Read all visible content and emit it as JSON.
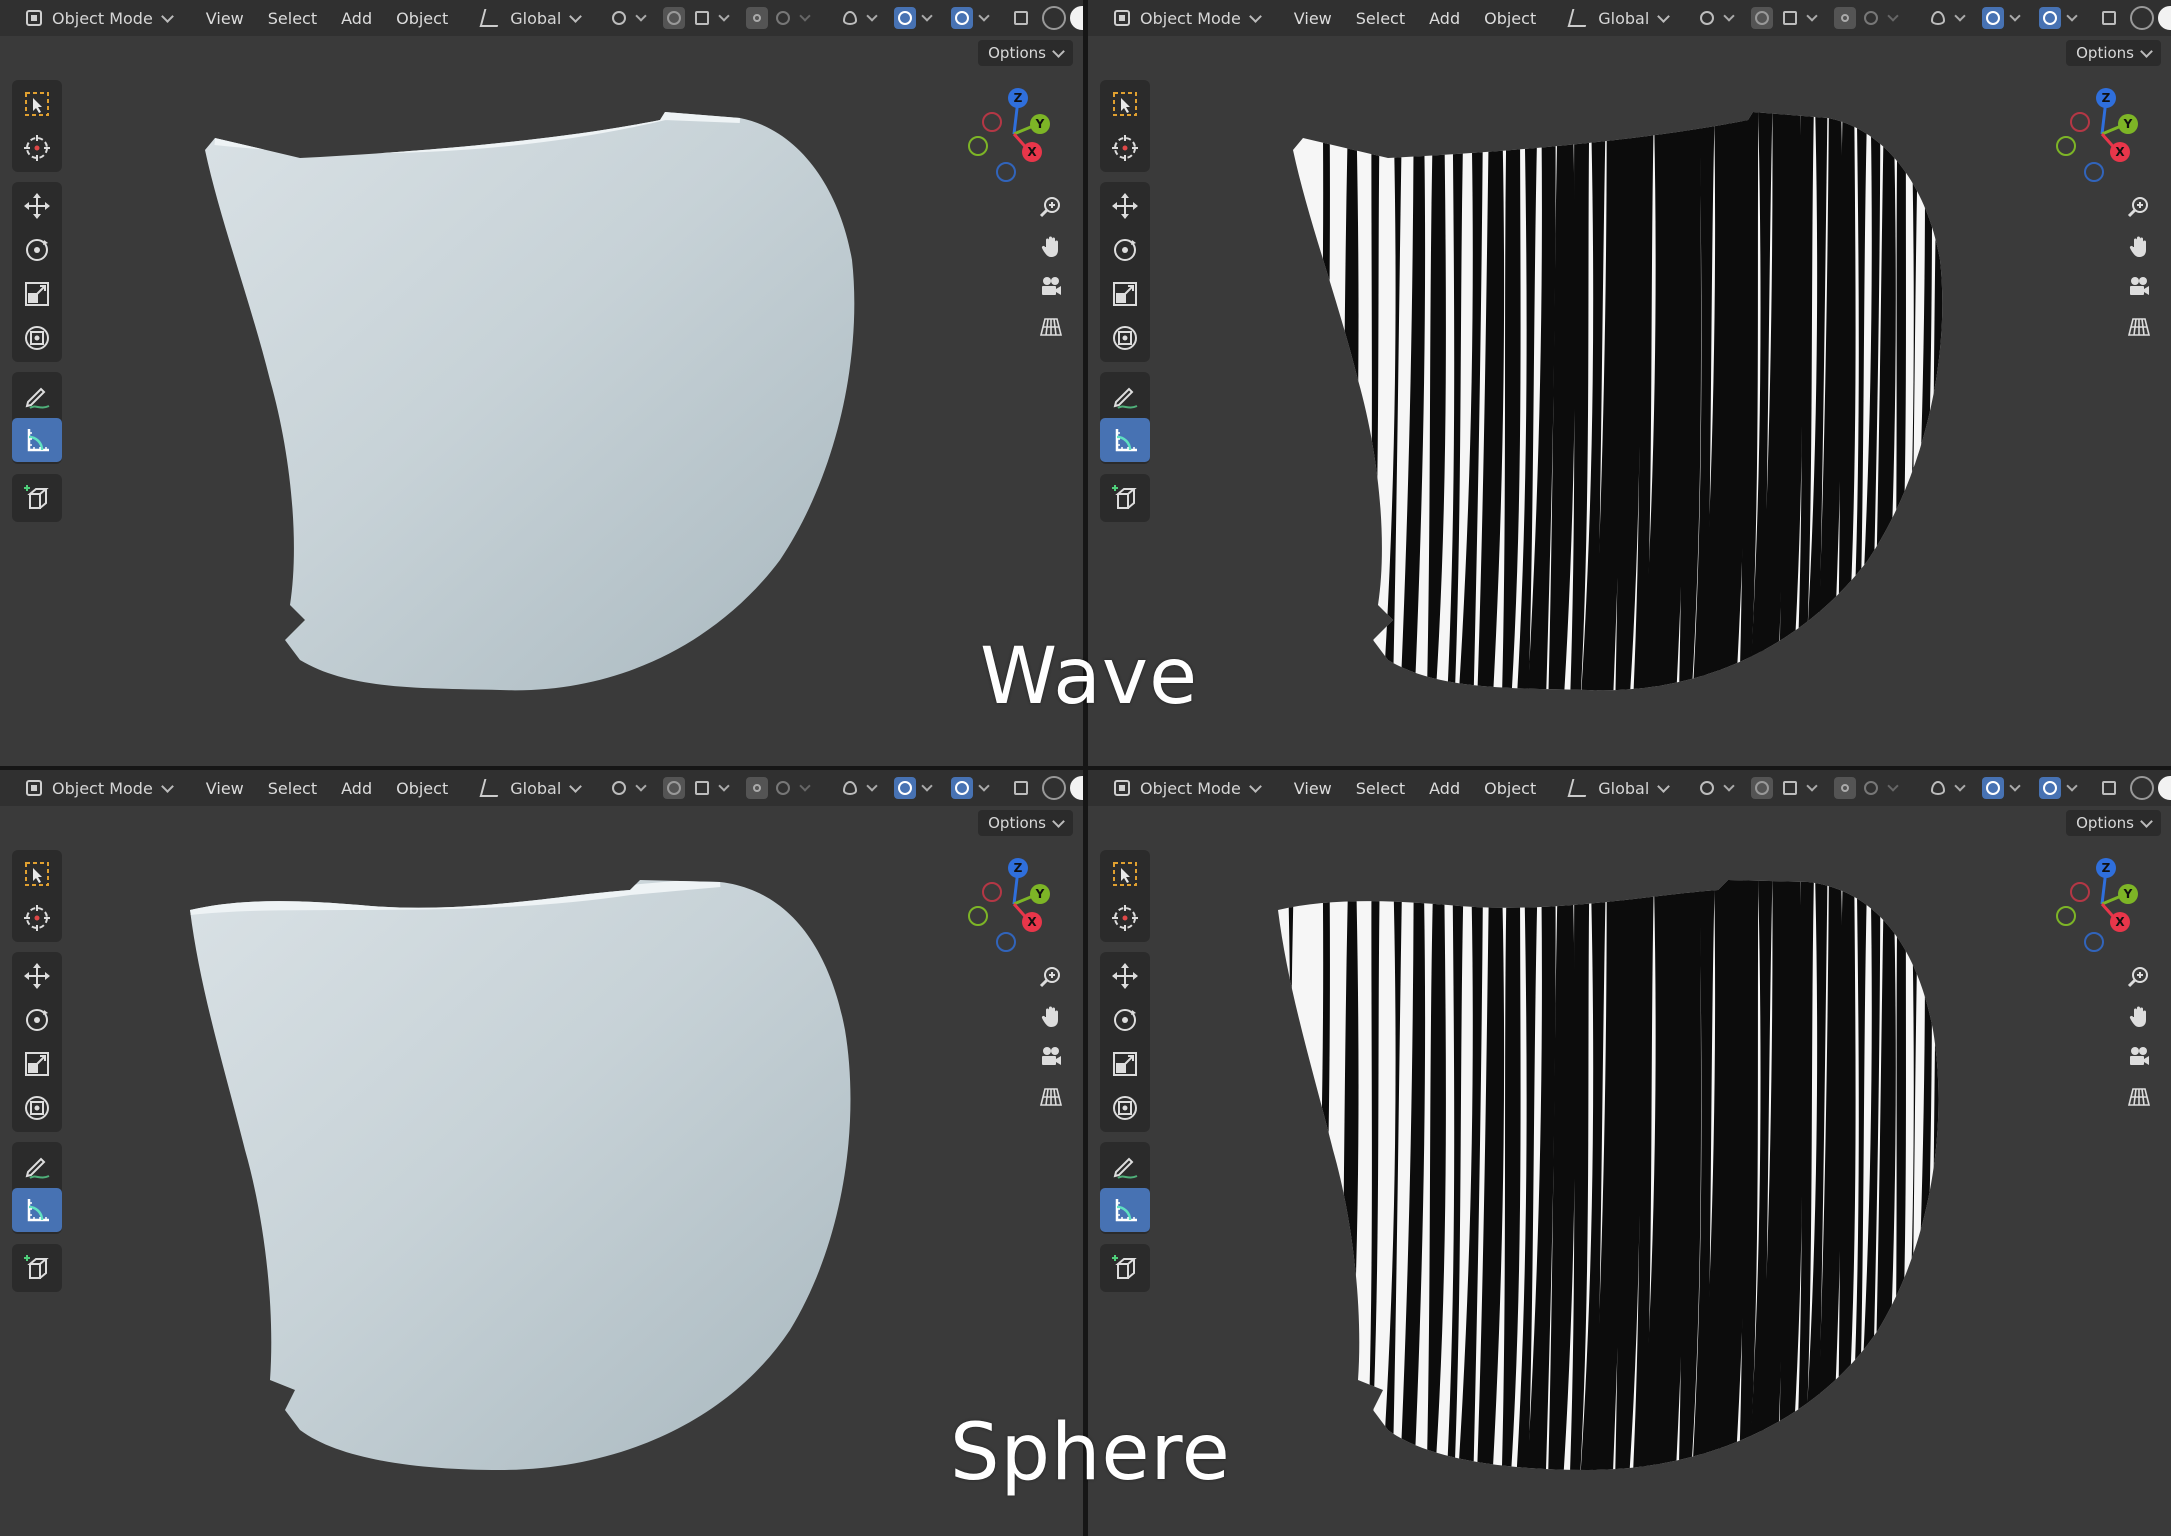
{
  "header": {
    "mode_label": "Object Mode",
    "menus": [
      "View",
      "Select",
      "Add",
      "Object"
    ],
    "orientation_label": "Global",
    "options_label": "Options"
  },
  "gizmo": {
    "z": "Z",
    "y": "Y",
    "x": "X",
    "colors": {
      "z": "#2f6fdc",
      "y": "#7db526",
      "x": "#e8364a"
    }
  },
  "toolbar": {
    "tools": [
      "select-box",
      "cursor",
      "move",
      "rotate",
      "scale",
      "transform",
      "annotate",
      "measure",
      "add-cube"
    ],
    "active_tool": "measure"
  },
  "viewports": [
    {
      "id": "top-left",
      "shading": "solid"
    },
    {
      "id": "top-right",
      "shading": "zebra"
    },
    {
      "id": "bottom-left",
      "shading": "solid"
    },
    {
      "id": "bottom-right",
      "shading": "zebra"
    }
  ],
  "captions": {
    "wave": "Wave",
    "sphere": "Sphere"
  },
  "colors": {
    "viewport_bg": "#3a3a3a",
    "header_bg": "#303030",
    "accent_blue": "#4772b3",
    "mesh_solid": "#c8d3d8"
  }
}
